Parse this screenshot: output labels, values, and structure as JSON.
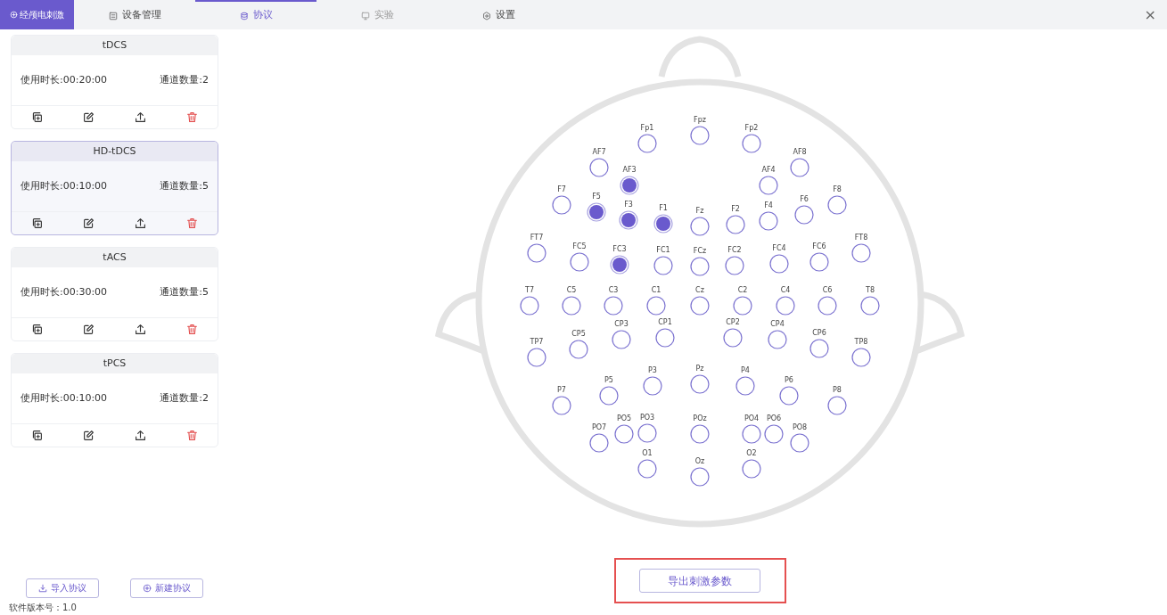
{
  "app": {
    "brand": "经颅电刺激"
  },
  "tabs": [
    {
      "label": "设备管理",
      "kind": "device",
      "selected": false,
      "disabled": false
    },
    {
      "label": "协议",
      "kind": "protocol",
      "selected": true,
      "disabled": false
    },
    {
      "label": "实验",
      "kind": "experiment",
      "selected": false,
      "disabled": true
    },
    {
      "label": "设置",
      "kind": "settings",
      "selected": false,
      "disabled": false
    }
  ],
  "close_icon": "×",
  "protocols": [
    {
      "name": "tDCS",
      "duration": "使用时长:00:20:00",
      "channels": "通道数量:2",
      "selected": false
    },
    {
      "name": "HD-tDCS",
      "duration": "使用时长:00:10:00",
      "channels": "通道数量:5",
      "selected": true
    },
    {
      "name": "tACS",
      "duration": "使用时长:00:30:00",
      "channels": "通道数量:5",
      "selected": false
    },
    {
      "name": "tPCS",
      "duration": "使用时长:00:10:00",
      "channels": "通道数量:2",
      "selected": false
    }
  ],
  "left_buttons": [
    {
      "label": "导入协议",
      "kind": "import"
    },
    {
      "label": "新建协议",
      "kind": "new"
    }
  ],
  "electrodes": [
    {
      "label": "Fp1",
      "selected": false
    },
    {
      "label": "Fpz",
      "selected": false
    },
    {
      "label": "Fp2",
      "selected": false
    },
    {
      "label": "AF7",
      "selected": false
    },
    {
      "label": "AF3",
      "selected": true
    },
    {
      "label": "AF4",
      "selected": false
    },
    {
      "label": "AF8",
      "selected": false
    },
    {
      "label": "F7",
      "selected": false
    },
    {
      "label": "F5",
      "selected": true
    },
    {
      "label": "F3",
      "selected": true
    },
    {
      "label": "F1",
      "selected": true
    },
    {
      "label": "Fz",
      "selected": false
    },
    {
      "label": "F2",
      "selected": false
    },
    {
      "label": "F4",
      "selected": false
    },
    {
      "label": "F6",
      "selected": false
    },
    {
      "label": "F8",
      "selected": false
    },
    {
      "label": "FT7",
      "selected": false
    },
    {
      "label": "FC5",
      "selected": false
    },
    {
      "label": "FC3",
      "selected": true
    },
    {
      "label": "FC1",
      "selected": false
    },
    {
      "label": "FCz",
      "selected": false
    },
    {
      "label": "FC2",
      "selected": false
    },
    {
      "label": "FC4",
      "selected": false
    },
    {
      "label": "FC6",
      "selected": false
    },
    {
      "label": "FT8",
      "selected": false
    },
    {
      "label": "T7",
      "selected": false
    },
    {
      "label": "C5",
      "selected": false
    },
    {
      "label": "C3",
      "selected": false
    },
    {
      "label": "C1",
      "selected": false
    },
    {
      "label": "Cz",
      "selected": false
    },
    {
      "label": "C2",
      "selected": false
    },
    {
      "label": "C4",
      "selected": false
    },
    {
      "label": "C6",
      "selected": false
    },
    {
      "label": "T8",
      "selected": false
    },
    {
      "label": "TP7",
      "selected": false
    },
    {
      "label": "CP5",
      "selected": false
    },
    {
      "label": "CP3",
      "selected": false
    },
    {
      "label": "CP1",
      "selected": false
    },
    {
      "label": "CP2",
      "selected": false
    },
    {
      "label": "CP4",
      "selected": false
    },
    {
      "label": "CP6",
      "selected": false
    },
    {
      "label": "TP8",
      "selected": false
    },
    {
      "label": "P7",
      "selected": false
    },
    {
      "label": "P5",
      "selected": false
    },
    {
      "label": "P3",
      "selected": false
    },
    {
      "label": "Pz",
      "selected": false
    },
    {
      "label": "P4",
      "selected": false
    },
    {
      "label": "P6",
      "selected": false
    },
    {
      "label": "P8",
      "selected": false
    },
    {
      "label": "PO7",
      "selected": false
    },
    {
      "label": "PO5",
      "selected": false
    },
    {
      "label": "PO3",
      "selected": false
    },
    {
      "label": "POz",
      "selected": false
    },
    {
      "label": "PO4",
      "selected": false
    },
    {
      "label": "PO6",
      "selected": false
    },
    {
      "label": "PO8",
      "selected": false
    },
    {
      "label": "O1",
      "selected": false
    },
    {
      "label": "Oz",
      "selected": false
    },
    {
      "label": "O2",
      "selected": false
    }
  ],
  "export_button": "导出刺激参数",
  "version": "软件版本号：1.0"
}
